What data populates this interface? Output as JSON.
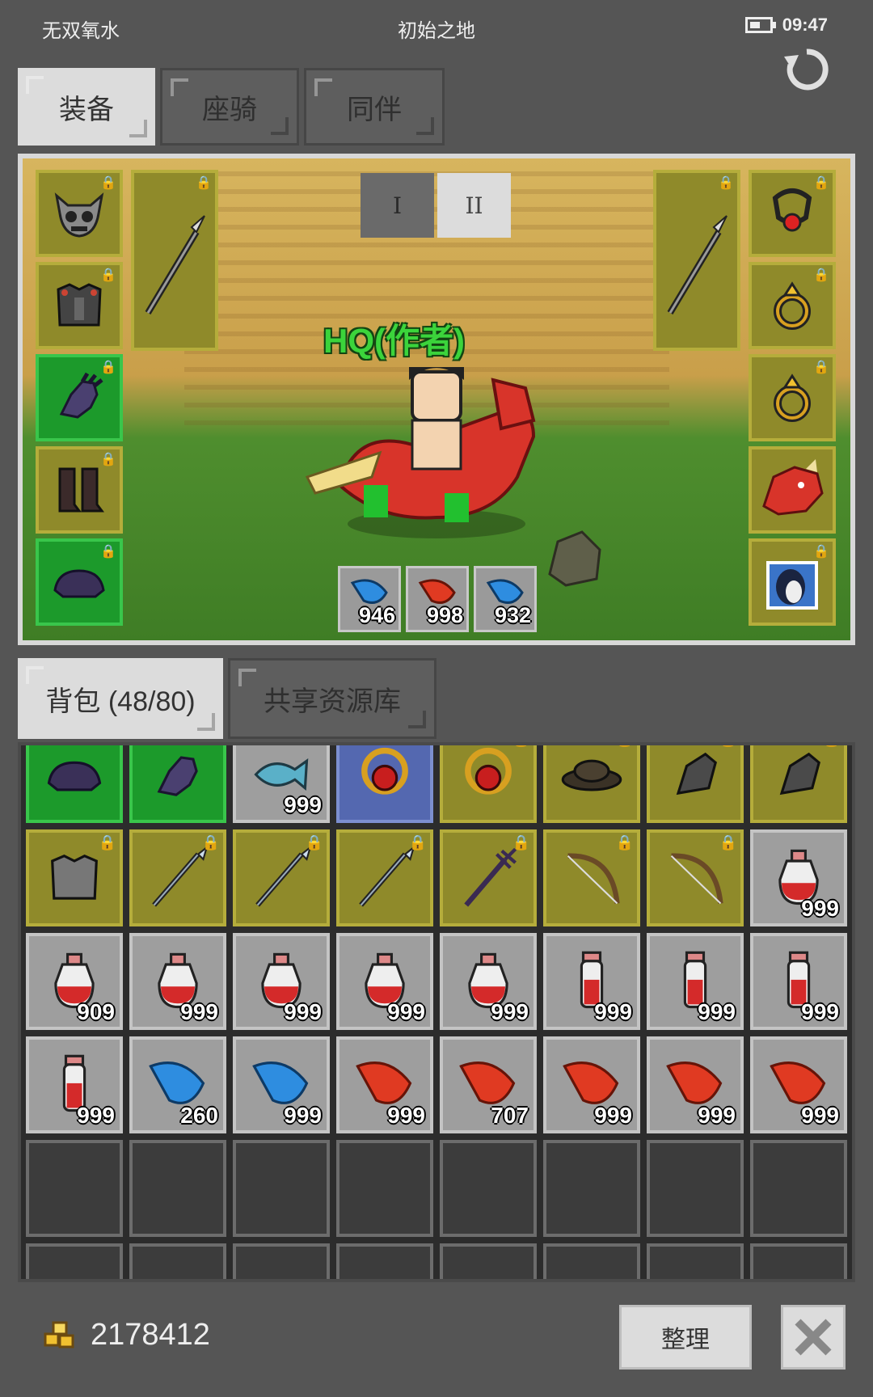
{
  "status_bar": {
    "left_text": "无双氧水",
    "center_text": "初始之地",
    "time": "09:47"
  },
  "top_tabs": [
    {
      "label": "装备",
      "active": true
    },
    {
      "label": "座骑",
      "active": false
    },
    {
      "label": "同伴",
      "active": false
    }
  ],
  "scene": {
    "toggle": {
      "option1": "I",
      "option2": "II",
      "selected": "II"
    },
    "hero_name": "HQ(作者)",
    "quickslots": [
      {
        "item": "blue-leaf-icon",
        "count": "946"
      },
      {
        "item": "red-leaf-icon",
        "count": "998"
      },
      {
        "item": "blue-leaf-icon",
        "count": "932"
      }
    ],
    "left_equipment": [
      "skull-helmet-icon",
      "armor-icon",
      "glove-icon",
      "boots-icon",
      "cloak-icon"
    ],
    "left_weapon": "spear-icon",
    "right_weapon": "spear-icon",
    "right_equipment": [
      "necklace-icon",
      "ring-icon",
      "ring-icon",
      "red-dragon-mount-icon",
      "penguin-pet-icon"
    ]
  },
  "bag_tabs": [
    {
      "label": "背包 (48/80)",
      "active": true
    },
    {
      "label": "共享资源库",
      "active": false
    }
  ],
  "inventory": {
    "rows": [
      [
        {
          "icon": "cloak-icon",
          "style": "g",
          "count": ""
        },
        {
          "icon": "glove-icon",
          "style": "g",
          "count": ""
        },
        {
          "icon": "fish-icon",
          "style": "s",
          "count": "999"
        },
        {
          "icon": "ruby-ring-icon",
          "style": "b",
          "count": ""
        },
        {
          "icon": "ruby-ring-icon",
          "style": "y",
          "count": ""
        },
        {
          "icon": "hat-icon",
          "style": "y",
          "count": ""
        },
        {
          "icon": "gauntlet-icon",
          "style": "y",
          "count": ""
        },
        {
          "icon": "gauntlet-icon",
          "style": "y",
          "count": ""
        }
      ],
      [
        {
          "icon": "armor-icon",
          "style": "y",
          "count": ""
        },
        {
          "icon": "spear-icon",
          "style": "y",
          "count": ""
        },
        {
          "icon": "spear-icon",
          "style": "y",
          "count": ""
        },
        {
          "icon": "spear-icon",
          "style": "y",
          "count": ""
        },
        {
          "icon": "trident-icon",
          "style": "y",
          "count": ""
        },
        {
          "icon": "bow-icon",
          "style": "y",
          "count": ""
        },
        {
          "icon": "bow-icon",
          "style": "y",
          "count": ""
        },
        {
          "icon": "red-potion-icon",
          "style": "s",
          "count": "999"
        }
      ],
      [
        {
          "icon": "red-potion-icon",
          "style": "s",
          "count": "909"
        },
        {
          "icon": "red-potion-icon",
          "style": "s",
          "count": "999"
        },
        {
          "icon": "red-potion-icon",
          "style": "s",
          "count": "999"
        },
        {
          "icon": "red-potion-icon",
          "style": "s",
          "count": "999"
        },
        {
          "icon": "red-potion-icon",
          "style": "s",
          "count": "999"
        },
        {
          "icon": "red-vial-icon",
          "style": "s",
          "count": "999"
        },
        {
          "icon": "red-vial-icon",
          "style": "s",
          "count": "999"
        },
        {
          "icon": "red-vial-icon",
          "style": "s",
          "count": "999"
        }
      ],
      [
        {
          "icon": "red-vial-icon",
          "style": "s",
          "count": "999"
        },
        {
          "icon": "blue-leaf-icon",
          "style": "s",
          "count": "260"
        },
        {
          "icon": "blue-leaf-icon",
          "style": "s",
          "count": "999"
        },
        {
          "icon": "red-leaf-icon",
          "style": "s",
          "count": "999"
        },
        {
          "icon": "red-leaf-icon",
          "style": "s",
          "count": "707"
        },
        {
          "icon": "red-leaf-icon",
          "style": "s",
          "count": "999"
        },
        {
          "icon": "red-leaf-icon",
          "style": "s",
          "count": "999"
        },
        {
          "icon": "red-leaf-icon",
          "style": "s",
          "count": "999"
        }
      ]
    ]
  },
  "footer": {
    "gold_amount": "2178412",
    "sort_label": "整理"
  },
  "colors": {
    "background": "#555555",
    "slot_yellow": "#8f8a2a",
    "slot_green": "#1c9a2b",
    "slot_blue": "#5468b0",
    "slot_gray": "#9e9e9e",
    "name_green": "#3bd43b"
  }
}
